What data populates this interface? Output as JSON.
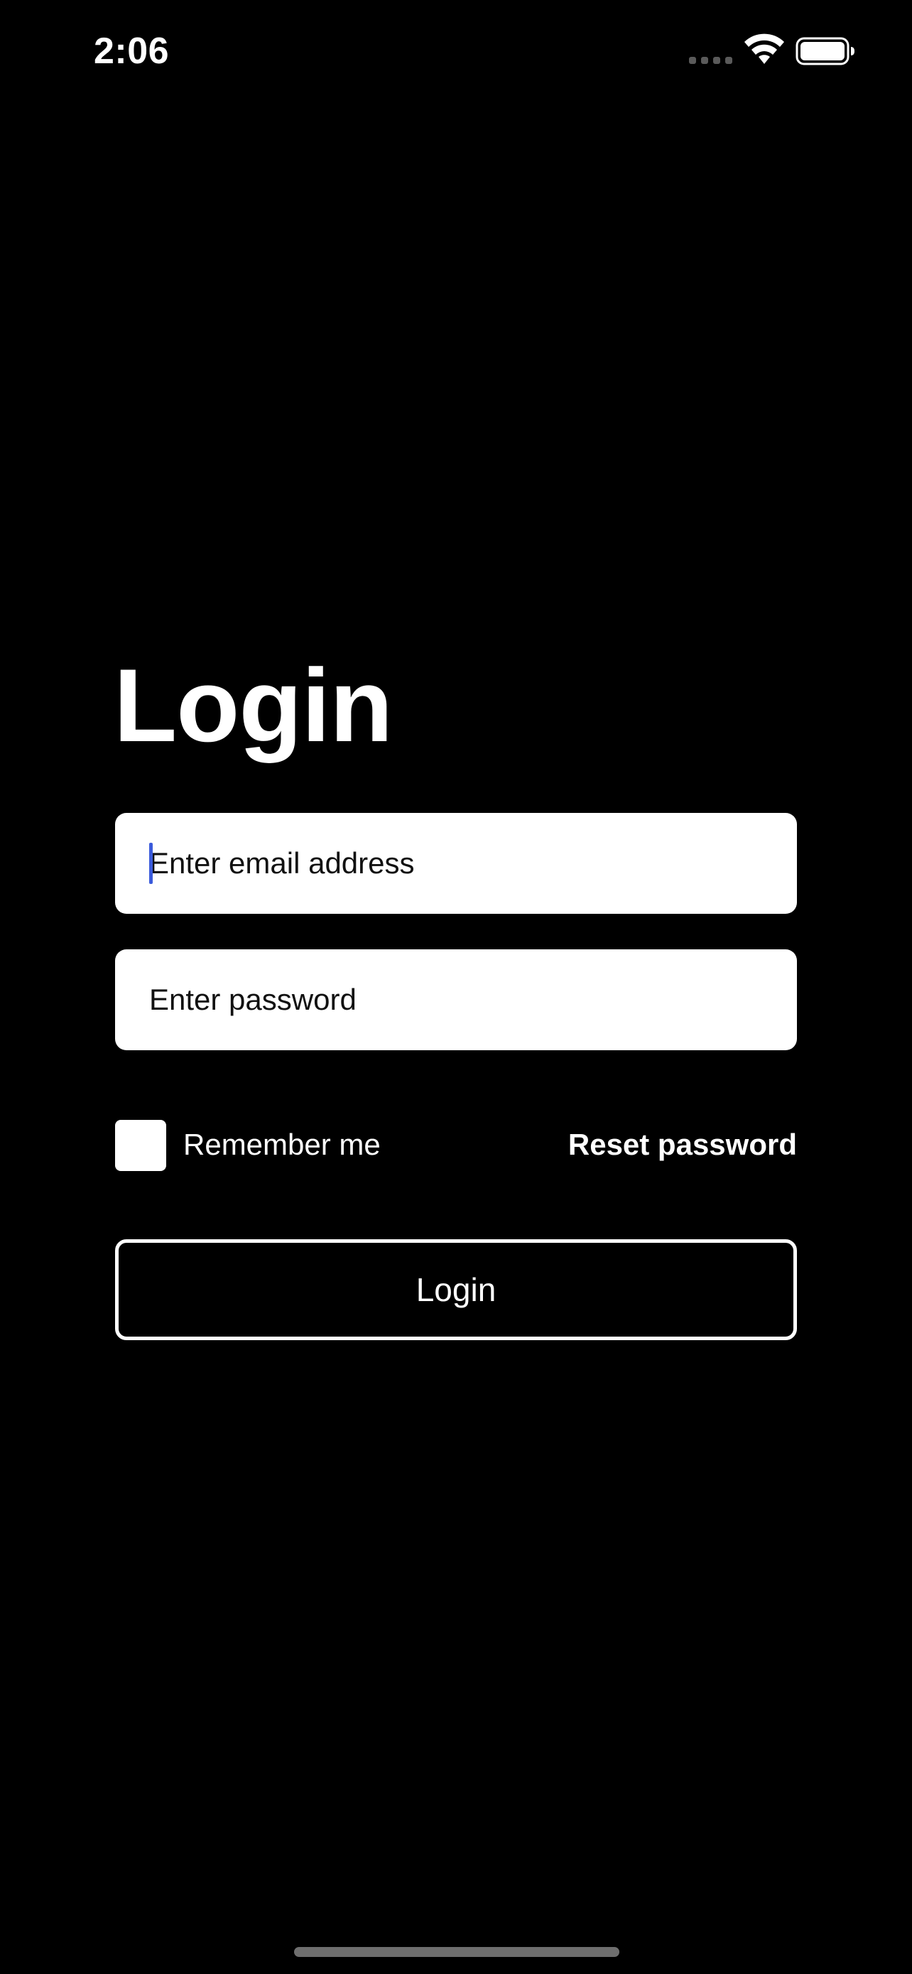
{
  "status_bar": {
    "time": "2:06",
    "icons": [
      "cellular-signal-icon",
      "wifi-icon",
      "battery-icon"
    ]
  },
  "login": {
    "title": "Login",
    "email": {
      "value": "",
      "placeholder": "Enter email address",
      "focused": true
    },
    "password": {
      "value": "",
      "placeholder": "Enter password"
    },
    "remember_me": {
      "label": "Remember me",
      "checked": false
    },
    "reset_password_label": "Reset password",
    "submit_label": "Login"
  },
  "colors": {
    "background": "#000000",
    "foreground": "#ffffff",
    "caret": "#3b5bdb"
  }
}
